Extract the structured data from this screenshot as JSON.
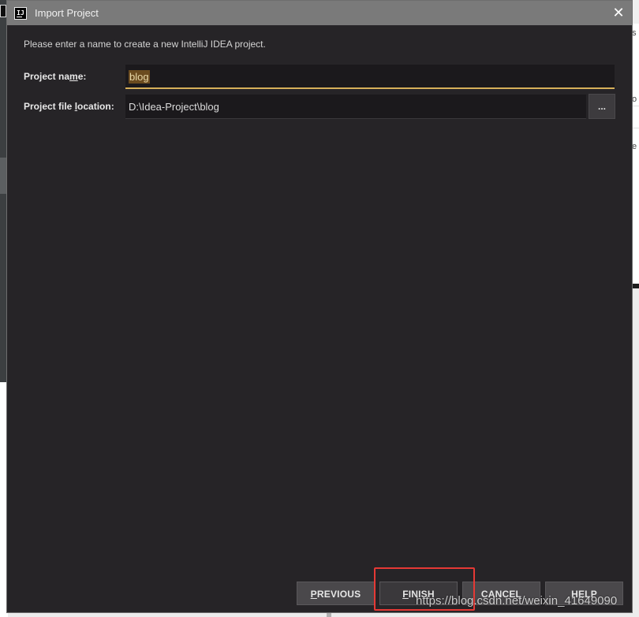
{
  "dialog": {
    "title": "Import Project",
    "app_icon_text": "IJ",
    "close_glyph": "✕",
    "intro": "Please enter a name to create a new IntelliJ IDEA project."
  },
  "form": {
    "name_label_pre": "Project na",
    "name_label_mn": "m",
    "name_label_post": "e:",
    "name_value": "blog",
    "location_label_pre": "Project file ",
    "location_label_mn": "l",
    "location_label_post": "ocation:",
    "location_value": "D:\\Idea-Project\\blog",
    "browse_label": "..."
  },
  "buttons": {
    "previous_mn": "P",
    "previous_rest": "REVIOUS",
    "finish_mn": "F",
    "finish_rest": "INISH",
    "cancel": "CANCEL",
    "help": "HELP"
  },
  "background": {
    "right_letters": [
      "s",
      "o",
      "e"
    ]
  },
  "watermark": "https://blog.csdn.net/weixin_41649090",
  "colors": {
    "dialog_bg": "#262427",
    "titlebar": "#7a7a7a",
    "focus_underline": "#d6b05a",
    "highlight_box": "#e53935"
  }
}
